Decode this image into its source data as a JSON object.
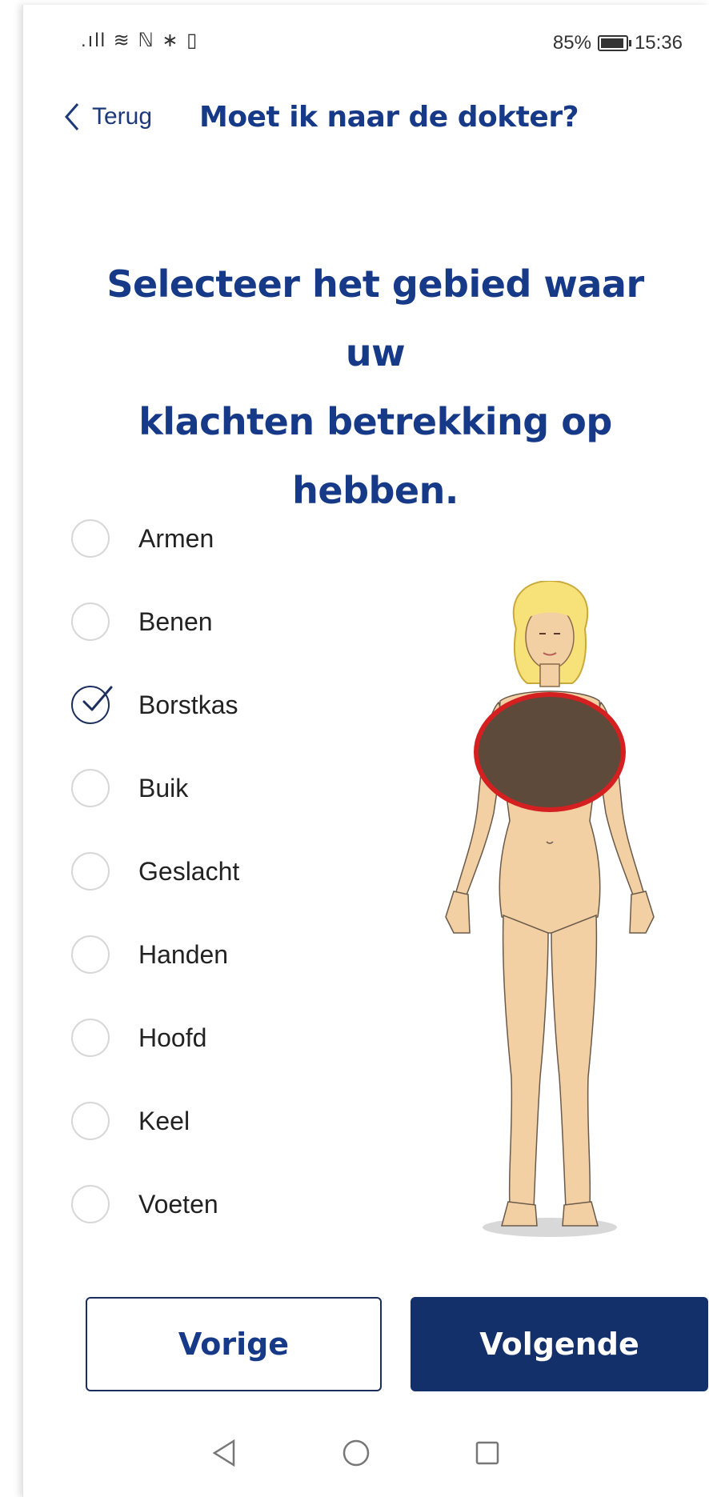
{
  "status_bar": {
    "left_icons": ".ıll ≋ ℕ ∗ ▯",
    "battery": "85%",
    "time": "15:36"
  },
  "header": {
    "back_label": "Terug",
    "title": "Moet ik naar de dokter?"
  },
  "question": {
    "line1": "Selecteer het gebied waar uw",
    "line2": "klachten betrekking op",
    "line3": "hebben."
  },
  "options": [
    {
      "label": "Armen",
      "checked": false
    },
    {
      "label": "Benen",
      "checked": false
    },
    {
      "label": "Borstkas",
      "checked": true
    },
    {
      "label": "Buik",
      "checked": false
    },
    {
      "label": "Geslacht",
      "checked": false
    },
    {
      "label": "Handen",
      "checked": false
    },
    {
      "label": "Hoofd",
      "checked": false
    },
    {
      "label": "Keel",
      "checked": false
    },
    {
      "label": "Voeten",
      "checked": false
    }
  ],
  "buttons": {
    "previous": "Vorige",
    "next": "Volgende"
  },
  "colors": {
    "brand_blue": "#163a88",
    "button_blue": "#14306b",
    "highlight_red": "#d42020",
    "skin": "#f2ceA2",
    "hair": "#f7e27a"
  },
  "icons": {
    "back": "chevron-left-icon",
    "check": "checkmark-icon",
    "nav_back": "triangle-back-icon",
    "nav_home": "circle-home-icon",
    "nav_recent": "square-recents-icon"
  }
}
